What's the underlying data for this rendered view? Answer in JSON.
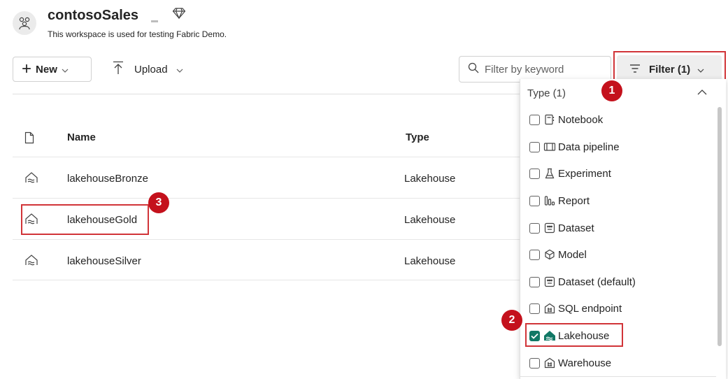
{
  "workspace": {
    "title": "contosoSales",
    "description": "This workspace is used for testing Fabric Demo."
  },
  "toolbar": {
    "new_label": "New",
    "upload_label": "Upload",
    "search_placeholder": "Filter by keyword",
    "filter_label": "Filter (1)"
  },
  "table": {
    "headers": {
      "name": "Name",
      "type": "Type"
    },
    "rows": [
      {
        "name": "lakehouseBronze",
        "type": "Lakehouse"
      },
      {
        "name": "lakehouseGold",
        "type": "Lakehouse"
      },
      {
        "name": "lakehouseSilver",
        "type": "Lakehouse"
      }
    ]
  },
  "filter_dropdown": {
    "header": "Type (1)",
    "items": [
      {
        "label": "Notebook",
        "checked": false,
        "icon": "notebook-icon"
      },
      {
        "label": "Data pipeline",
        "checked": false,
        "icon": "data-pipeline-icon"
      },
      {
        "label": "Experiment",
        "checked": false,
        "icon": "experiment-icon"
      },
      {
        "label": "Report",
        "checked": false,
        "icon": "report-icon"
      },
      {
        "label": "Dataset",
        "checked": false,
        "icon": "dataset-icon"
      },
      {
        "label": "Model",
        "checked": false,
        "icon": "model-icon"
      },
      {
        "label": "Dataset (default)",
        "checked": false,
        "icon": "dataset-icon"
      },
      {
        "label": "SQL endpoint",
        "checked": false,
        "icon": "sql-endpoint-icon"
      },
      {
        "label": "Lakehouse",
        "checked": true,
        "icon": "lakehouse-icon"
      },
      {
        "label": "Warehouse",
        "checked": false,
        "icon": "warehouse-icon"
      }
    ]
  },
  "annotations": {
    "badge_1": "1",
    "badge_2": "2",
    "badge_3": "3"
  },
  "colors": {
    "highlight": "#d13438",
    "badge": "#c4111c",
    "checked": "#117865"
  }
}
